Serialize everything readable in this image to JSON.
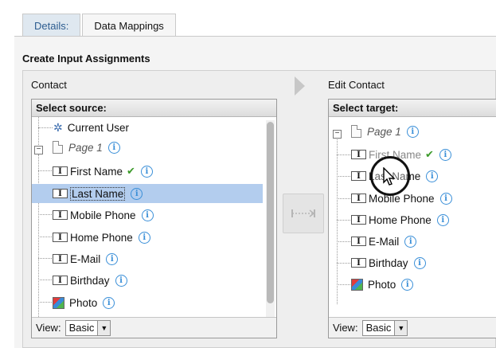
{
  "tabs": [
    {
      "label": "Details:",
      "active": false
    },
    {
      "label": "Data Mappings",
      "active": true
    }
  ],
  "section_title": "Create Input Assignments",
  "source": {
    "column_label": "Contact",
    "header": "Select source:",
    "items": {
      "current_user": "Current User",
      "page1": "Page 1",
      "first_name": "First Name",
      "last_name": "Last Name",
      "mobile_phone": "Mobile Phone",
      "home_phone": "Home Phone",
      "email": "E-Mail",
      "birthday": "Birthday",
      "photo": "Photo"
    },
    "view_label": "View:",
    "view_value": "Basic"
  },
  "target": {
    "column_label": "Edit Contact",
    "header": "Select target:",
    "items": {
      "page1": "Page 1",
      "first_name": "First Name",
      "last_name": "Last Name",
      "mobile_phone": "Mobile Phone",
      "home_phone": "Home Phone",
      "email": "E-Mail",
      "birthday": "Birthday",
      "photo": "Photo"
    },
    "view_label": "View:",
    "view_value": "Basic"
  },
  "icons": {
    "info": "info-icon",
    "check": "check-icon",
    "gear": "gear-icon",
    "page": "page-icon",
    "field": "text-field-icon",
    "photo": "photo-icon"
  },
  "colors": {
    "selection": "#b3cdee",
    "tab_link": "#2c5c8f",
    "info": "#3a8fd8",
    "check": "#3c9a2a"
  }
}
